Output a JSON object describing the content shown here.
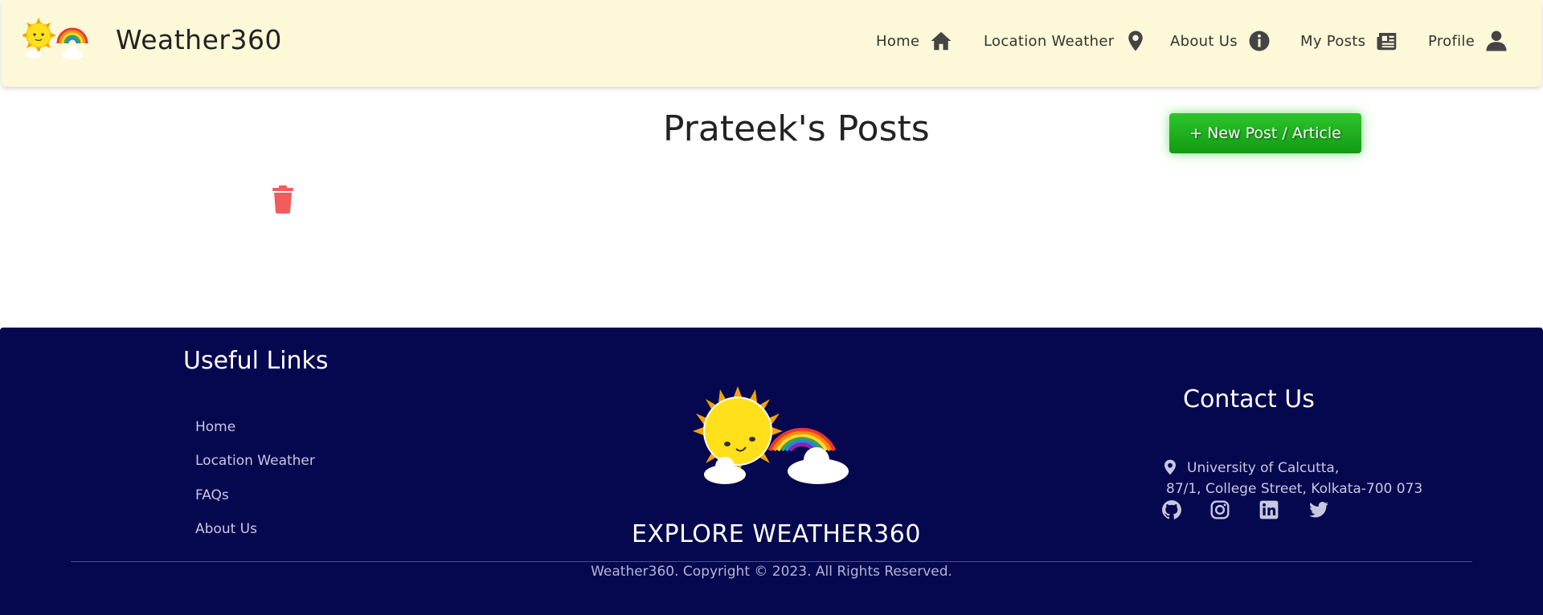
{
  "brand": {
    "name": "Weather360"
  },
  "nav": {
    "items": [
      {
        "label": "Home",
        "icon": "home-icon"
      },
      {
        "label": "Location Weather",
        "icon": "map-pin-icon"
      },
      {
        "label": "About Us",
        "icon": "info-icon"
      },
      {
        "label": "My Posts",
        "icon": "newspaper-icon"
      },
      {
        "label": "Profile",
        "icon": "user-icon"
      }
    ]
  },
  "main": {
    "title": "Prateek's Posts",
    "new_post_label": "+ New Post / Article",
    "delete_icon": "trash-icon"
  },
  "footer": {
    "useful_links_title": "Useful Links",
    "links": [
      "Home",
      "Location Weather",
      "FAQs",
      "About Us"
    ],
    "explore": "EXPLORE WEATHER360",
    "contact_title": "Contact Us",
    "address_line1": "University of Calcutta,",
    "address_line2": "87/1, College Street, Kolkata-700 073",
    "social": [
      "github-icon",
      "instagram-icon",
      "linkedin-icon",
      "twitter-icon"
    ],
    "copyright": "Weather360. Copyright © 2023. All Rights Reserved."
  },
  "colors": {
    "navbar_bg": "#fcf8d8",
    "footer_bg": "#05074f",
    "button_green": "#20b820",
    "trash_red": "#f25c5c"
  }
}
